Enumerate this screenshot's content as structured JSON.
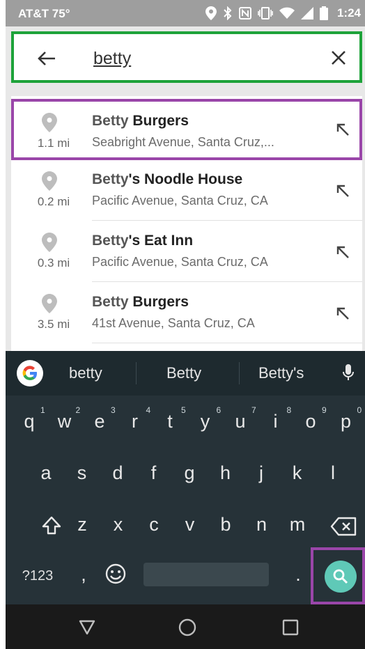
{
  "status": {
    "carrier": "AT&T 75°",
    "time": "1:24",
    "icons": [
      "location-icon",
      "bluetooth-icon",
      "nfc-icon",
      "vibrate-icon",
      "wifi-icon",
      "signal-icon",
      "battery-icon"
    ]
  },
  "search": {
    "value": "betty",
    "back_icon": "arrow-left-icon",
    "clear_icon": "close-icon"
  },
  "results": [
    {
      "match": "Betty",
      "rest": " Burgers",
      "address": "Seabright Avenue, Santa Cruz,...",
      "distance": "1.1 mi",
      "highlighted": true
    },
    {
      "match": "Betty",
      "rest": "'s Noodle House",
      "address": "Pacific Avenue, Santa Cruz, CA",
      "distance": "0.2 mi",
      "highlighted": false
    },
    {
      "match": "Betty",
      "rest": "'s Eat Inn",
      "address": "Pacific Avenue, Santa Cruz, CA",
      "distance": "0.3 mi",
      "highlighted": false
    },
    {
      "match": "Betty",
      "rest": " Burgers",
      "address": "41st Avenue, Santa Cruz, CA",
      "distance": "3.5 mi",
      "highlighted": false
    }
  ],
  "keyboard": {
    "suggestions": [
      "betty",
      "Betty",
      "Betty's"
    ],
    "row1": [
      {
        "k": "q",
        "h": "1"
      },
      {
        "k": "w",
        "h": "2"
      },
      {
        "k": "e",
        "h": "3"
      },
      {
        "k": "r",
        "h": "4"
      },
      {
        "k": "t",
        "h": "5"
      },
      {
        "k": "y",
        "h": "6"
      },
      {
        "k": "u",
        "h": "7"
      },
      {
        "k": "i",
        "h": "8"
      },
      {
        "k": "o",
        "h": "9"
      },
      {
        "k": "p",
        "h": "0"
      }
    ],
    "row2": [
      "a",
      "s",
      "d",
      "f",
      "g",
      "h",
      "j",
      "k",
      "l"
    ],
    "row3": [
      "z",
      "x",
      "c",
      "v",
      "b",
      "n",
      "m"
    ],
    "symbols_key": "?123",
    "comma_key": ",",
    "period_key": "."
  },
  "colors": {
    "search_highlight": "#1ea33a",
    "result_highlight": "#9a46a9",
    "search_key": "#5fc9b7",
    "keyboard_bg": "#263238"
  }
}
